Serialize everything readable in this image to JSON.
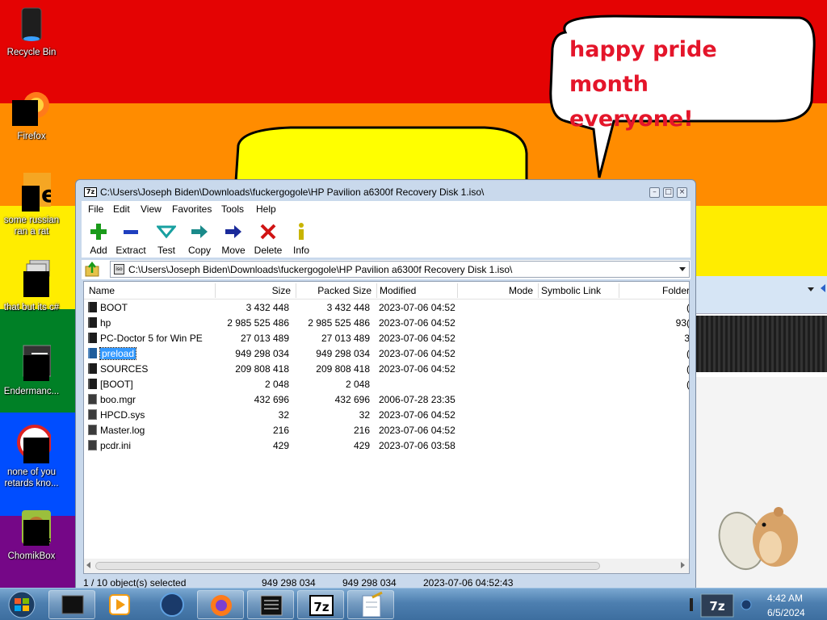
{
  "wallpaper": {
    "stripes": [
      "#e40303",
      "#ff8c00",
      "#ffed00",
      "#008026",
      "#004dff",
      "#750787"
    ]
  },
  "bubble": {
    "line1": "happy pride month",
    "line2": "everyone!",
    "text_color": "#e4152a"
  },
  "desktop_icons": [
    {
      "label": "Recycle Bin",
      "icon": "recycle-bin-icon"
    },
    {
      "label": "Firefox",
      "icon": "firefox-icon"
    },
    {
      "label": "some russian ran a rat",
      "icon": "program-icon"
    },
    {
      "label": "that but its c#",
      "icon": "program-icon"
    },
    {
      "label": "Endermanc...",
      "icon": "program-icon"
    },
    {
      "label": "none of you retards kno...",
      "icon": "program-icon"
    },
    {
      "label": "ChomikBox",
      "icon": "chomikbox-icon"
    }
  ],
  "window": {
    "title": "C:\\Users\\Joseph Biden\\Downloads\\fuckergogole\\HP Pavilion a6300f Recovery Disk 1.iso\\",
    "app_icon_text": "7z",
    "menu": [
      "File",
      "Edit",
      "View",
      "Favorites",
      "Tools",
      "Help"
    ],
    "toolbar": [
      {
        "label": "Add",
        "icon": "add-icon",
        "color": "#1a9b1a"
      },
      {
        "label": "Extract",
        "icon": "extract-icon",
        "color": "#1f3fbf"
      },
      {
        "label": "Test",
        "icon": "test-icon",
        "color": "#18a0a0"
      },
      {
        "label": "Copy",
        "icon": "copy-icon",
        "color": "#1a8a8a"
      },
      {
        "label": "Move",
        "icon": "move-icon",
        "color": "#1a2a9a"
      },
      {
        "label": "Delete",
        "icon": "delete-icon",
        "color": "#d01414"
      },
      {
        "label": "Info",
        "icon": "info-icon",
        "color": "#c8b400"
      }
    ],
    "address": "C:\\Users\\Joseph Biden\\Downloads\\fuckergogole\\HP Pavilion a6300f Recovery Disk 1.iso\\",
    "columns": {
      "name": "Name",
      "size": "Size",
      "packed": "Packed Size",
      "modified": "Modified",
      "mode": "Mode",
      "symlink": "Symbolic Link",
      "folders": "Folder"
    },
    "rows": [
      {
        "name": "BOOT",
        "size": "3 432 448",
        "packed": "3 432 448",
        "modified": "2023-07-06 04:52",
        "folders": "(",
        "type": "folder"
      },
      {
        "name": "hp",
        "size": "2 985 525 486",
        "packed": "2 985 525 486",
        "modified": "2023-07-06 04:52",
        "folders": "93(",
        "type": "folder"
      },
      {
        "name": "PC-Doctor 5 for Win PE",
        "size": "27 013 489",
        "packed": "27 013 489",
        "modified": "2023-07-06 04:52",
        "folders": "3",
        "type": "folder"
      },
      {
        "name": "preload",
        "size": "949 298 034",
        "packed": "949 298 034",
        "modified": "2023-07-06 04:52",
        "folders": "(",
        "type": "folder-blue",
        "selected": true
      },
      {
        "name": "SOURCES",
        "size": "209 808 418",
        "packed": "209 808 418",
        "modified": "2023-07-06 04:52",
        "folders": "(",
        "type": "folder"
      },
      {
        "name": "[BOOT]",
        "size": "2 048",
        "packed": "2 048",
        "modified": "",
        "folders": "(",
        "type": "folder"
      },
      {
        "name": "boo.mgr",
        "size": "432 696",
        "packed": "432 696",
        "modified": "2006-07-28 23:35",
        "folders": "",
        "type": "file"
      },
      {
        "name": "HPCD.sys",
        "size": "32",
        "packed": "32",
        "modified": "2023-07-06 04:52",
        "folders": "",
        "type": "file"
      },
      {
        "name": "Master.log",
        "size": "216",
        "packed": "216",
        "modified": "2023-07-06 04:52",
        "folders": "",
        "type": "file"
      },
      {
        "name": "pcdr.ini",
        "size": "429",
        "packed": "429",
        "modified": "2023-07-06 03:58",
        "folders": "",
        "type": "file"
      }
    ],
    "status": {
      "selection": "1 / 10 object(s) selected",
      "size": "949 298 034",
      "packed": "949 298 034",
      "modified": "2023-07-06 04:52:43"
    }
  },
  "taskbar": {
    "apps": [
      "explorer-icon",
      "media-player-icon",
      "browser-globe-icon",
      "firefox-icon",
      "console-icon",
      "7zip-icon",
      "notepad-icon"
    ],
    "tray_app_text": "7z",
    "time": "4:42 AM",
    "date": "6/5/2024"
  }
}
